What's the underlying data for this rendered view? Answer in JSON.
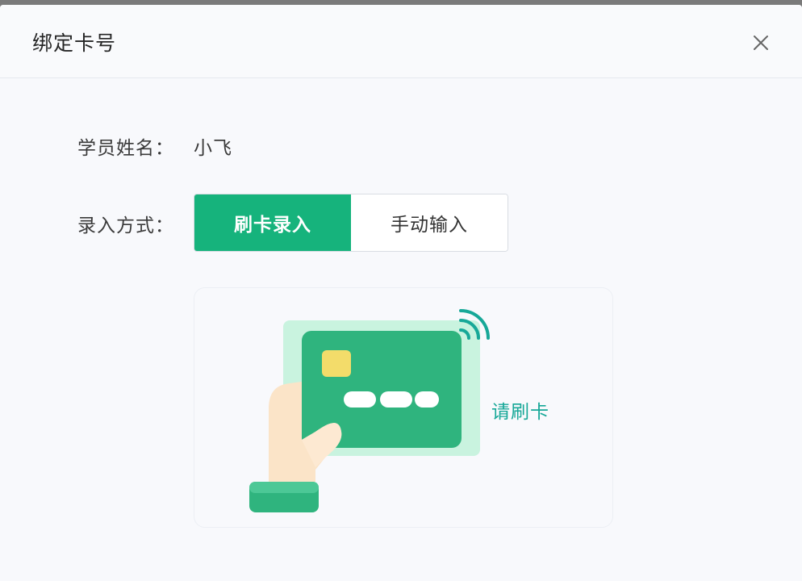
{
  "dialog": {
    "title": "绑定卡号",
    "close_icon": "close-icon"
  },
  "form": {
    "name_label": "学员姓名：",
    "name_value": "小飞",
    "mode_label": "录入方式：",
    "modes": [
      {
        "label": "刷卡录入",
        "active": true
      },
      {
        "label": "手动输入",
        "active": false
      }
    ]
  },
  "card_area": {
    "hint": "请刷卡",
    "icons": [
      "card-swipe-icon",
      "wifi-signal-icon",
      "hand-icon"
    ]
  },
  "colors": {
    "accent": "#16b37c",
    "hint_text": "#17a898",
    "card": "#2fb47e",
    "card_glow": "#c9f3df",
    "chip": "#f3dc6a",
    "hand": "#fbe4c8"
  }
}
